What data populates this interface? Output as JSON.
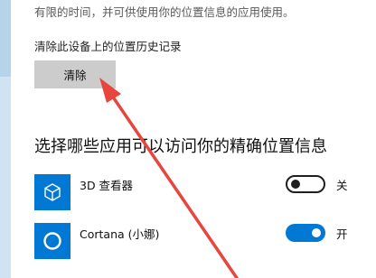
{
  "description": "有限的时间，并可供使用你的位置信息的应用使用。",
  "history": {
    "label": "清除此设备上的位置历史记录",
    "clear_button": "清除"
  },
  "apps_heading": "选择哪些应用可以访问你的精确位置信息",
  "apps": [
    {
      "name": "3D 查看器",
      "icon": "cube-icon",
      "state_label": "关",
      "enabled": false
    },
    {
      "name": "Cortana (小娜)",
      "icon": "cortana-ring-icon",
      "state_label": "开",
      "enabled": true
    }
  ],
  "colors": {
    "accent": "#0078d4",
    "annotation_arrow": "#e8453c",
    "button_bg": "#cccccc"
  }
}
